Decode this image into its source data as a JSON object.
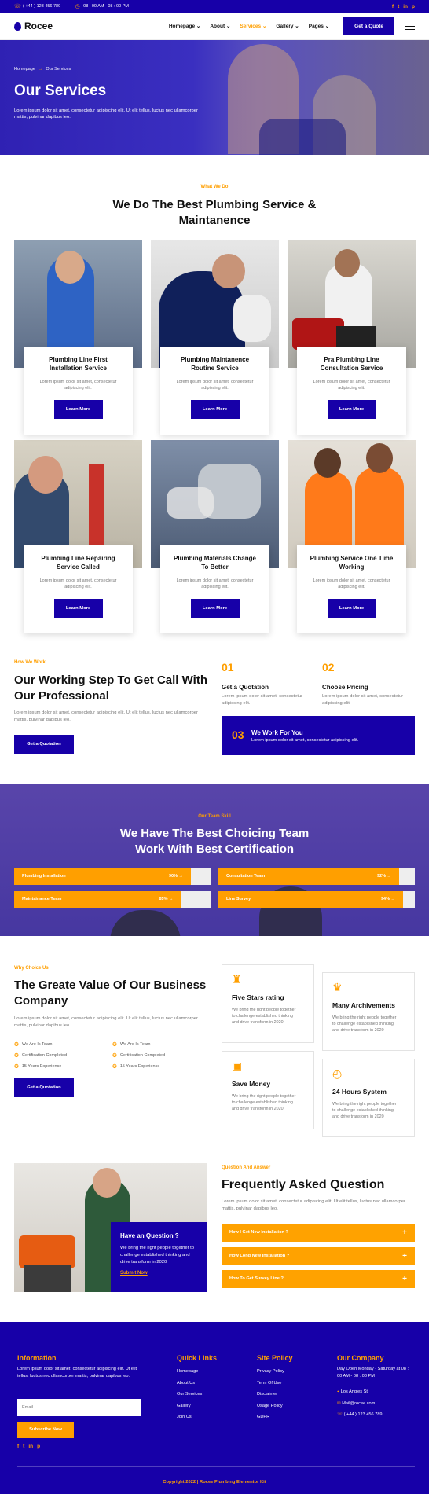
{
  "topbar": {
    "phone": "( +44 ) 123 456 789",
    "hours": "08 : 00 AM - 08 : 00 PM",
    "social": [
      "f",
      "t",
      "in",
      "p"
    ]
  },
  "nav": {
    "brand": "Rocee",
    "items": [
      "Homepage",
      "About",
      "Services",
      "Gallery",
      "Pages"
    ],
    "active": "Services",
    "quote": "Get a Quote"
  },
  "hero": {
    "crumb_home": "Homepage",
    "crumb_current": "Our Services",
    "title": "Our Services",
    "text": "Lorem ipsum dolor sit amet, consectetur adipiscing elit. Ut elit tellus, luctus nec ullamcorper mattis, pulvinar dapibus leo."
  },
  "services": {
    "eyebrow": "What We Do",
    "title_l1": "We Do The Best Plumbing Service &",
    "title_l2": "Maintanence",
    "cards": [
      {
        "t1": "Plumbing Line First",
        "t2": "Installation Service",
        "d1": "Lorem ipsum dolor sit amet, consectetur",
        "d2": "adipiscing elit.",
        "btn": "Learn More"
      },
      {
        "t1": "Plumbing Maintanence",
        "t2": "Routine Service",
        "d1": "Lorem ipsum dolor sit amet, consectetur",
        "d2": "adipiscing elit.",
        "btn": "Learn More"
      },
      {
        "t1": "Pra Plumbing Line",
        "t2": "Consultation Service",
        "d1": "Lorem ipsum dolor sit amet, consectetur",
        "d2": "adipiscing elit.",
        "btn": "Learn More"
      },
      {
        "t1": "Plumbing Line Repairing",
        "t2": "Service Called",
        "d1": "Lorem ipsum dolor sit amet, consectetur",
        "d2": "adipiscing elit.",
        "btn": "Learn More"
      },
      {
        "t1": "Plumbing Materials Change",
        "t2": "To Better",
        "d1": "Lorem ipsum dolor sit amet, consectetur",
        "d2": "adipiscing elit.",
        "btn": "Learn More"
      },
      {
        "t1": "Plumbing Service One Time",
        "t2": "Working",
        "d1": "Lorem ipsum dolor sit amet, consectetur",
        "d2": "adipiscing elit.",
        "btn": "Learn More"
      }
    ]
  },
  "work": {
    "eyebrow": "How We Work",
    "title_l1": "Our Working Step To Get Call With",
    "title_l2": "Our Professional",
    "text": "Lorem ipsum dolor sit amet, consectetur adipiscing elit. Ut elit tellus, luctus nec ullamcorper mattis, pulvinar dapibus leo.",
    "btn": "Get a Quotation",
    "steps": [
      {
        "num": "01",
        "title": "Get a Quotation",
        "text": "Lorem ipsum dolor sit amet, consectetur adipiscing elit."
      },
      {
        "num": "02",
        "title": "Choose Pricing",
        "text": "Lorem ipsum dolor sit amet, consectetur adipiscing elit."
      },
      {
        "num": "03",
        "title": "We Work For You",
        "text": "Lorem ipsum dolor sit amet, consectetur adipiscing elit."
      }
    ]
  },
  "team": {
    "eyebrow": "Our Team Skill",
    "title_l1": "We Have The Best Choicing Team",
    "title_l2": "Work With Best Certification",
    "skills": [
      {
        "name": "Plumbing Installation",
        "pct": "90%",
        "value": 90
      },
      {
        "name": "Consultation Team",
        "pct": "92%",
        "value": 92
      },
      {
        "name": "Maintainance Team",
        "pct": "85%",
        "value": 85
      },
      {
        "name": "Line Survey",
        "pct": "94%",
        "value": 94
      }
    ]
  },
  "why": {
    "eyebrow": "Why Choice Us",
    "title_l1": "The Greate Value Of Our Business",
    "title_l2": "Company",
    "text": "Lorem ipsum dolor sit amet, consectetur adipiscing elit. Ut elit tellus, luctus nec ullamcorper mattis, pulvinar dapibus leo.",
    "checks": [
      "We Are Is Team",
      "We Are Is Team",
      "Certification Completed",
      "Certification Completed",
      "15 Years Experience",
      "15 Years Experience"
    ],
    "btn": "Get a Quotation",
    "features": [
      {
        "title": "Five Stars rating",
        "l1": "We bring the right people together",
        "l2": "to challenge established thinking",
        "l3": "and drive transform in 2020",
        "icon": "trophy-icon"
      },
      {
        "title": "Many Archivements",
        "l1": "We bring the right people together",
        "l2": "to challenge established thinking",
        "l3": "and drive transform in 2020",
        "icon": "cup-icon"
      },
      {
        "title": "Save Money",
        "l1": "We bring the right people together",
        "l2": "to challenge established thinking",
        "l3": "and drive transform in 2020",
        "icon": "money-icon"
      },
      {
        "title": "24 Hours System",
        "l1": "We bring the right people together",
        "l2": "to challenge established thinking",
        "l3": "and drive transform in 2020",
        "icon": "clock-icon"
      }
    ]
  },
  "faq": {
    "q_title": "Have an Question ?",
    "q_text": "We bring the right people together to challenge established thinking and drive transform in 2020",
    "q_link": "Submit Now",
    "eyebrow": "Question And Answer",
    "title": "Frequently Asked Question",
    "text": "Lorem ipsum dolor sit amet, consectetur adipiscing elit. Ut elit tellus, luctus nec ullamcorper mattis, pulvinar dapibus leo.",
    "items": [
      "How I Get New Installation ?",
      "How Long New Installation ?",
      "How To Get Survey Line ?"
    ]
  },
  "footer": {
    "info_title": "Information",
    "info_text": "Lorem ipsum dolor sit amet, consectetur adipiscing elit. Ut elit tellus, luctus nec ullamcorper mattis, pulvinar dapibus leo.",
    "email_placeholder": "Email",
    "subscribe": "Subscribe Now",
    "links_title": "Quick Links",
    "links": [
      "Homepage",
      "About Us",
      "Our Services",
      "Gallery",
      "Join Us"
    ],
    "policy_title": "Site Policy",
    "policy": [
      "Privacy Policy",
      "Term Of Use",
      "Disclaimer",
      "Usage Policy",
      "GDPR"
    ],
    "company_title": "Our Company",
    "company_hours": "Day Open Monday - Saturday at 08 : 00 AM - 08 : 00 PM",
    "company_city": "Los Angles St.",
    "company_mail": "Mail@rocee.com",
    "company_phone": "( +44 ) 123 456 789",
    "copyright": "Copyright 2022 | Rocee Plumbing Elementor Kit"
  },
  "colors": {
    "primary": "#1700a8",
    "accent": "#ff9f00"
  }
}
